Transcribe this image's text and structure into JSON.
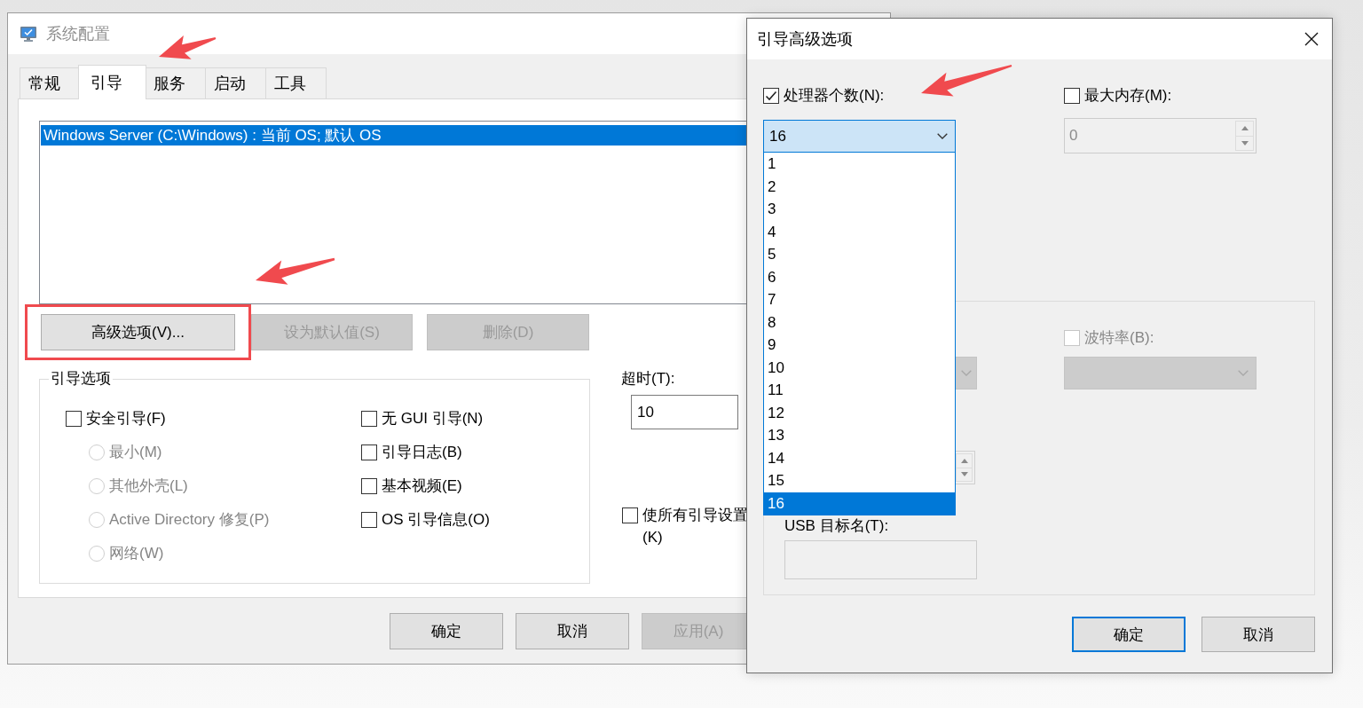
{
  "main_window": {
    "title": "系统配置",
    "active": false,
    "tabs": [
      {
        "label": "常规",
        "selected": false
      },
      {
        "label": "引导",
        "selected": true
      },
      {
        "label": "服务",
        "selected": false
      },
      {
        "label": "启动",
        "selected": false
      },
      {
        "label": "工具",
        "selected": false
      }
    ],
    "boot_entries": [
      {
        "text": "Windows Server (C:\\Windows) : 当前 OS; 默认 OS",
        "selected": true
      }
    ],
    "actions": [
      {
        "label": "高级选项(V)...",
        "disabled": false,
        "highlighted": true
      },
      {
        "label": "设为默认值(S)",
        "disabled": true,
        "highlighted": false
      },
      {
        "label": "删除(D)",
        "disabled": true,
        "highlighted": false
      }
    ],
    "boot_options": {
      "title": "引导选项",
      "columns": [
        [
          {
            "kind": "checkbox",
            "label": "安全引导(F)",
            "checked": false,
            "disabled": false
          },
          {
            "kind": "radio",
            "label": "最小(M)",
            "selected": false,
            "disabled": true
          },
          {
            "kind": "radio",
            "label": "其他外壳(L)",
            "selected": false,
            "disabled": true
          },
          {
            "kind": "radio",
            "label": "Active Directory 修复(P)",
            "selected": false,
            "disabled": true
          },
          {
            "kind": "radio",
            "label": "网络(W)",
            "selected": false,
            "disabled": true
          }
        ],
        [
          {
            "kind": "checkbox",
            "label": "无 GUI 引导(N)",
            "checked": false,
            "disabled": false
          },
          {
            "kind": "checkbox",
            "label": "引导日志(B)",
            "checked": false,
            "disabled": false
          },
          {
            "kind": "checkbox",
            "label": "基本视频(E)",
            "checked": false,
            "disabled": false
          },
          {
            "kind": "checkbox",
            "label": "OS 引导信息(O)",
            "checked": false,
            "disabled": false
          }
        ]
      ]
    },
    "timeout": {
      "label": "超时(T):",
      "value": "10"
    },
    "make_permanent": {
      "lines": [
        "使所有引导设置",
        "(K)"
      ],
      "checked": false
    },
    "footer_buttons": [
      {
        "label": "确定",
        "disabled": false
      },
      {
        "label": "取消",
        "disabled": false
      },
      {
        "label": "应用(A)",
        "disabled": true
      }
    ]
  },
  "advanced_dialog": {
    "title": "引导高级选项",
    "active": true,
    "processors": {
      "label": "处理器个数(N):",
      "checked": true,
      "value": "16",
      "expanded": true,
      "options": [
        {
          "label": "1",
          "selected": false
        },
        {
          "label": "2",
          "selected": false
        },
        {
          "label": "3",
          "selected": false
        },
        {
          "label": "4",
          "selected": false
        },
        {
          "label": "5",
          "selected": false
        },
        {
          "label": "6",
          "selected": false
        },
        {
          "label": "7",
          "selected": false
        },
        {
          "label": "8",
          "selected": false
        },
        {
          "label": "9",
          "selected": false
        },
        {
          "label": "10",
          "selected": false
        },
        {
          "label": "11",
          "selected": false
        },
        {
          "label": "12",
          "selected": false
        },
        {
          "label": "13",
          "selected": false
        },
        {
          "label": "14",
          "selected": false
        },
        {
          "label": "15",
          "selected": false
        },
        {
          "label": "16",
          "selected": true
        }
      ]
    },
    "max_memory": {
      "label": "最大内存(M):",
      "checked": false,
      "value": "0",
      "disabled": true
    },
    "debug_group": {
      "partly_covered": [
        {
          "kind": "dropdown",
          "disabled": true
        },
        {
          "kind": "spinner",
          "disabled": true
        }
      ],
      "baud_rate": {
        "label": "波特率(B):",
        "checked": false,
        "disabled": true
      },
      "usb_target": {
        "label": "USB 目标名(T):",
        "disabled": true
      }
    },
    "buttons": [
      {
        "label": "确定",
        "default": true
      },
      {
        "label": "取消",
        "default": false
      }
    ]
  }
}
